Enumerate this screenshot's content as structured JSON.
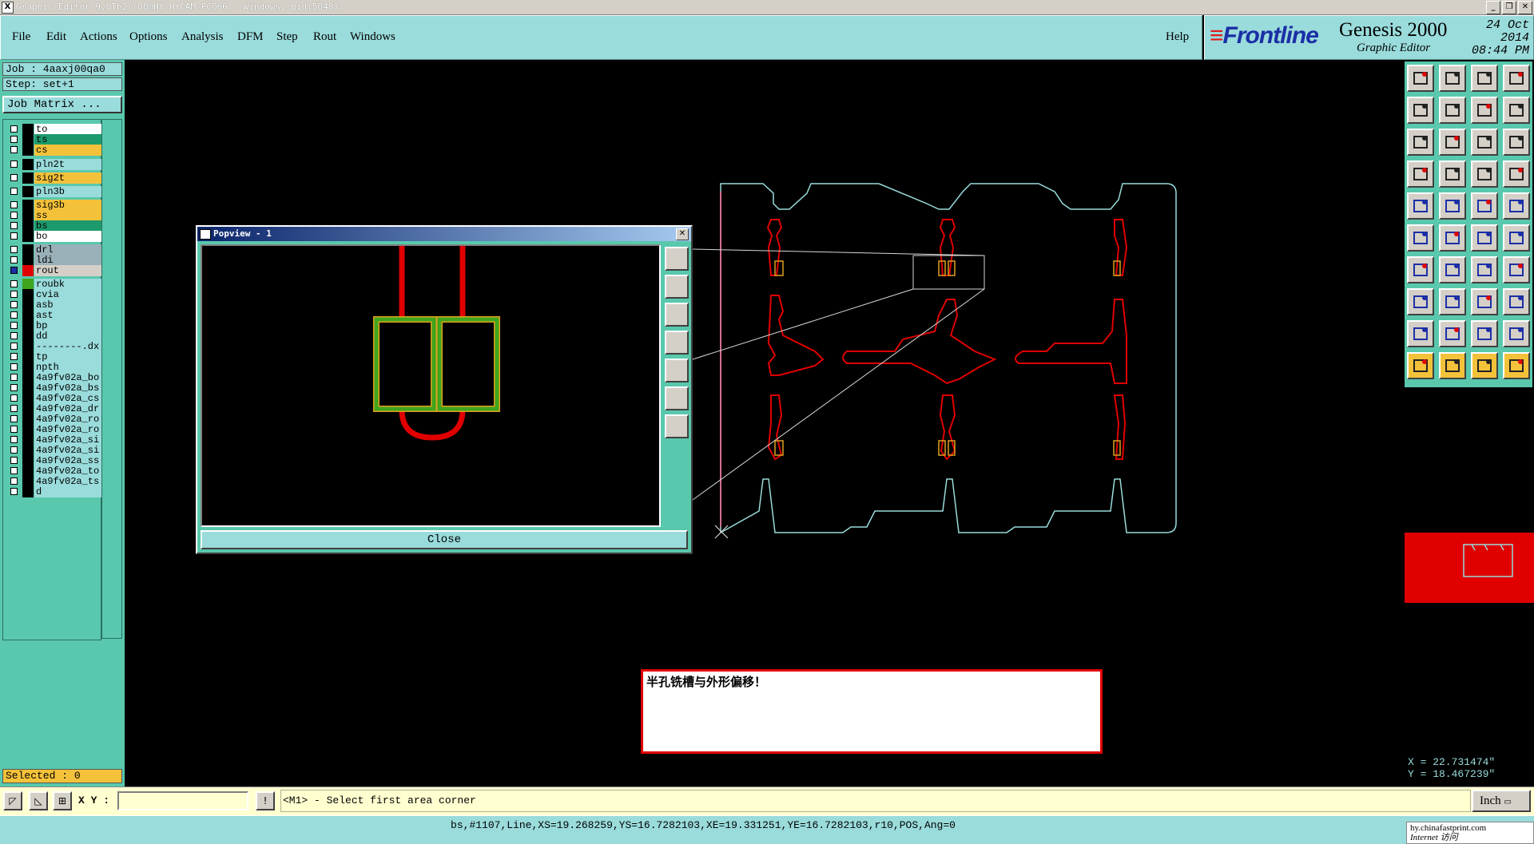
{
  "window": {
    "title": "Graphic Editor 9.0Tb2 (00@HY-HYCAM-PC066 - Windows, pid:5048)"
  },
  "menu": {
    "items": [
      "File",
      "Edit",
      "Actions",
      "Options",
      "Analysis",
      "DFM",
      "Step",
      "Rout",
      "Windows"
    ],
    "help": "Help"
  },
  "brand": {
    "logo": "Frontline",
    "product": "Genesis 2000",
    "subtitle": "Graphic Editor",
    "date": "24 Oct 2014",
    "time": "08:44 PM"
  },
  "job": {
    "job": "Job : 4aaxj00qa0",
    "step": "Step: set+1",
    "job_matrix": "Job Matrix ..."
  },
  "layers": [
    {
      "name": "to",
      "color": "#ffffff",
      "checked": false
    },
    {
      "name": "ts",
      "color": "#1c9a6c",
      "checked": false
    },
    {
      "name": "cs",
      "color": "#f4c23a",
      "checked": false
    },
    {
      "name": "pln2t",
      "color": "#9adbdb",
      "checked": false
    },
    {
      "name": "sig2t",
      "color": "#f4c23a",
      "checked": false
    },
    {
      "name": "pln3b",
      "color": "#9adbdb",
      "checked": false
    },
    {
      "name": "sig3b",
      "color": "#f4c23a",
      "checked": false
    },
    {
      "name": "ss",
      "color": "#f4c23a",
      "checked": false
    },
    {
      "name": "bs",
      "color": "#1c9a6c",
      "checked": false
    },
    {
      "name": "bo",
      "color": "#ffffff",
      "checked": false
    },
    {
      "name": "drl",
      "color": "#9ab0b8",
      "checked": false
    },
    {
      "name": "ldi",
      "color": "#9ab0b8",
      "checked": false
    },
    {
      "name": "rout",
      "color": "#d4d0c8",
      "checked": true,
      "swatch": "#e00000"
    },
    {
      "name": "roubk",
      "color": "#9adbdb",
      "checked": false,
      "swatch": "#3fa51c"
    },
    {
      "name": "cvia",
      "color": "#9adbdb",
      "checked": false
    },
    {
      "name": "asb",
      "color": "#9adbdb",
      "checked": false
    },
    {
      "name": "ast",
      "color": "#9adbdb",
      "checked": false
    },
    {
      "name": "bp",
      "color": "#9adbdb",
      "checked": false
    },
    {
      "name": "dd",
      "color": "#9adbdb",
      "checked": false
    },
    {
      "name": "--------.dx",
      "color": "#9adbdb",
      "checked": false
    },
    {
      "name": "tp",
      "color": "#9adbdb",
      "checked": false
    },
    {
      "name": "npth",
      "color": "#9adbdb",
      "checked": false
    },
    {
      "name": "4a9fv02a_bo",
      "color": "#9adbdb",
      "checked": false
    },
    {
      "name": "4a9fv02a_bs",
      "color": "#9adbdb",
      "checked": false
    },
    {
      "name": "4a9fv02a_cs",
      "color": "#9adbdb",
      "checked": false
    },
    {
      "name": "4a9fv02a_dr",
      "color": "#9adbdb",
      "checked": false
    },
    {
      "name": "4a9fv02a_ro",
      "color": "#9adbdb",
      "checked": false
    },
    {
      "name": "4a9fv02a_ro",
      "color": "#9adbdb",
      "checked": false
    },
    {
      "name": "4a9fv02a_si",
      "color": "#9adbdb",
      "checked": false
    },
    {
      "name": "4a9fv02a_si",
      "color": "#9adbdb",
      "checked": false
    },
    {
      "name": "4a9fv02a_ss",
      "color": "#9adbdb",
      "checked": false
    },
    {
      "name": "4a9fv02a_to",
      "color": "#9adbdb",
      "checked": false
    },
    {
      "name": "4a9fv02a_ts",
      "color": "#9adbdb",
      "checked": false
    },
    {
      "name": "d",
      "color": "#9adbdb",
      "checked": false
    }
  ],
  "selected": "Selected : 0",
  "cmd": {
    "xy_label": "X Y :",
    "xy_value": "",
    "prompt": "<M1> - Select first area corner",
    "unit": "Inch"
  },
  "status": "bs,#1107,Line,XS=19.268259,YS=16.7282103,XE=19.331251,YE=16.7282103,r10,POS,Ang=0",
  "watermark": {
    "line1": "hy.chinafastprint.com",
    "line2": "Internet 访问"
  },
  "coords": {
    "x": "X = 22.731474\"",
    "y": "Y = 18.467239\""
  },
  "popview": {
    "title": "Popview - 1",
    "close": "Close"
  },
  "message": "半孔铣槽与外形偏移！",
  "colors": {
    "rout": "#e00000",
    "pad": "#3fa51c",
    "pad_outline": "#e0a020",
    "outline": "#9adbdb",
    "panel": "#59c8ad",
    "menu": "#9adbdb"
  }
}
